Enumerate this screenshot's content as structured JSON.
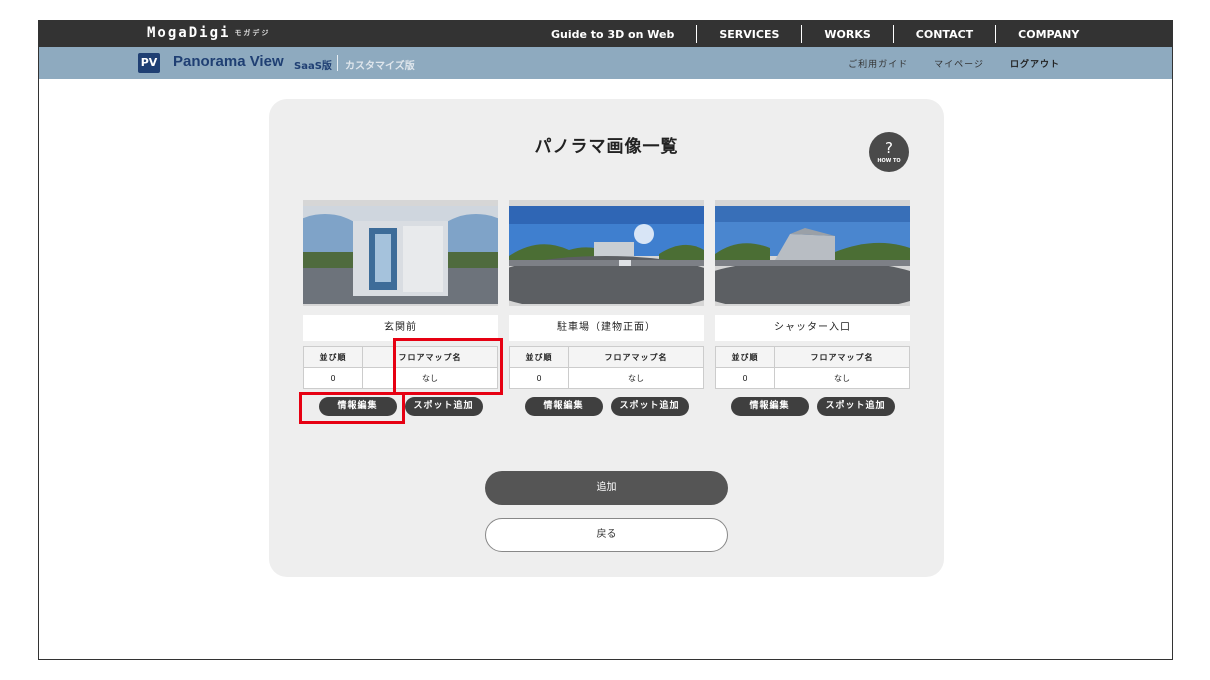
{
  "header": {
    "logo": "MogaDigi",
    "logo_sub": "モガデジ",
    "nav": [
      "Guide to 3D on Web",
      "SERVICES",
      "WORKS",
      "CONTACT",
      "COMPANY"
    ]
  },
  "subheader": {
    "badge": "PV",
    "brand": "Panorama View",
    "saas": "SaaS版",
    "custom": "カスタマイズ版",
    "links": [
      "ご利用ガイド",
      "マイページ",
      "ログアウト"
    ]
  },
  "main": {
    "title": "パノラマ画像一覧",
    "howto": {
      "symbol": "?",
      "label": "HOW TO"
    },
    "columns": {
      "order": "並び順",
      "floormap": "フロアマップ名"
    },
    "buttons": {
      "edit": "情報編集",
      "spot": "スポット追加"
    },
    "items": [
      {
        "name": "玄関前",
        "order": "0",
        "floormap": "なし"
      },
      {
        "name": "駐車場（建物正面）",
        "order": "0",
        "floormap": "なし"
      },
      {
        "name": "シャッター入口",
        "order": "0",
        "floormap": "なし"
      }
    ],
    "add_label": "追加",
    "back_label": "戻る"
  },
  "colors": {
    "topbar": "#333333",
    "subbar": "#8eaabf",
    "brand": "#1f3f73",
    "highlight": "#e60012",
    "pill": "#3f3f3f"
  }
}
